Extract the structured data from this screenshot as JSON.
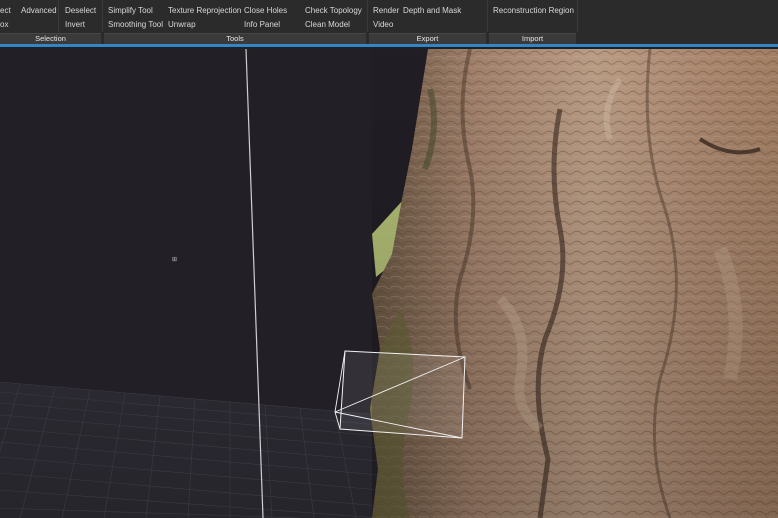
{
  "ribbon": {
    "selection": {
      "label": "Selection",
      "col1": [
        "ect",
        "ox"
      ],
      "col2": [
        "Advanced"
      ],
      "col3": [
        "Deselect",
        "Invert"
      ]
    },
    "tools": {
      "label": "Tools",
      "col1": [
        "Simplify Tool",
        "Smoothing Tool"
      ],
      "col2": [
        "Texture Reprojection",
        "Unwrap"
      ],
      "col3": [
        "Close Holes",
        "Info Panel"
      ],
      "col4": [
        "Check Topology",
        "Clean Model"
      ]
    },
    "export": {
      "label": "Export",
      "col1": [
        "Render",
        "Video"
      ],
      "col2": [
        "Depth and Mask"
      ]
    },
    "import": {
      "label": "Import",
      "col1": [
        "Reconstruction Region"
      ]
    }
  },
  "colors": {
    "accent": "#2f86c8",
    "viewport_bg": "#231f27",
    "ribbon_bg": "#2b2b2b"
  },
  "viewport": {
    "content": "3d-model-tree-bark",
    "grid": true,
    "camera_frustum": true
  }
}
